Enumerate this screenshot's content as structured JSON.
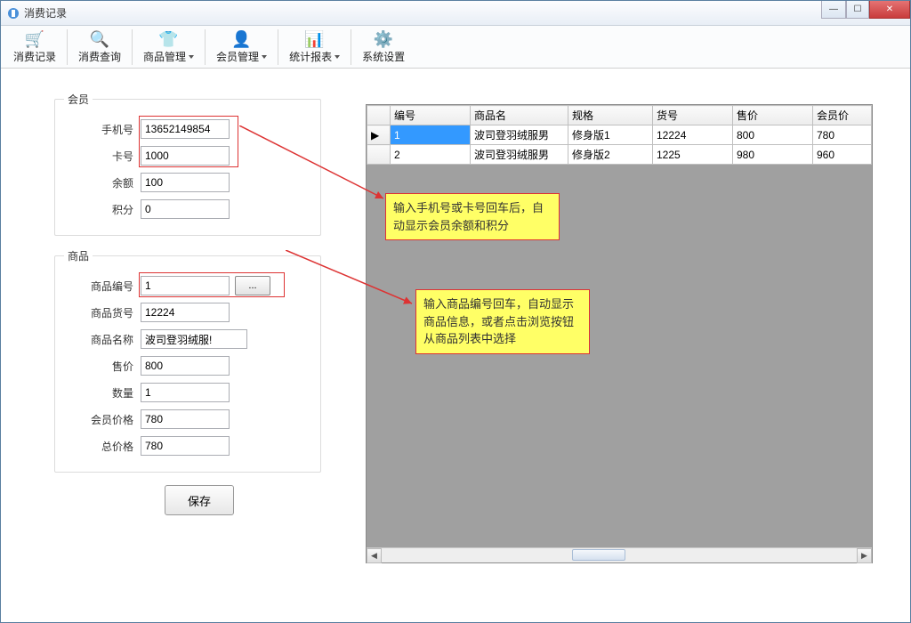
{
  "window": {
    "title": "消费记录"
  },
  "toolbar": [
    {
      "label": "消费记录",
      "dropdown": false
    },
    {
      "label": "消费查询",
      "dropdown": false
    },
    {
      "label": "商品管理",
      "dropdown": true
    },
    {
      "label": "会员管理",
      "dropdown": true
    },
    {
      "label": "统计报表",
      "dropdown": true
    },
    {
      "label": "系统设置",
      "dropdown": false
    }
  ],
  "member": {
    "legend": "会员",
    "phone_label": "手机号",
    "phone_value": "13652149854",
    "card_label": "卡号",
    "card_value": "1000",
    "balance_label": "余额",
    "balance_value": "100",
    "points_label": "积分",
    "points_value": "0"
  },
  "product": {
    "legend": "商品",
    "code_label": "商品编号",
    "code_value": "1",
    "browse_label": "...",
    "sku_label": "商品货号",
    "sku_value": "12224",
    "name_label": "商品名称",
    "name_value": "波司登羽绒服!",
    "price_label": "售价",
    "price_value": "800",
    "qty_label": "数量",
    "qty_value": "1",
    "member_price_label": "会员价格",
    "member_price_value": "780",
    "total_label": "总价格",
    "total_value": "780"
  },
  "save_label": "保存",
  "grid": {
    "headers": [
      "编号",
      "商品名",
      "规格",
      "货号",
      "售价",
      "会员价"
    ],
    "rows": [
      {
        "ptr": "▶",
        "cells": [
          "1",
          "波司登羽绒服男",
          "修身版1",
          "12224",
          "800",
          "780"
        ],
        "selected_col": 0
      },
      {
        "ptr": "",
        "cells": [
          "2",
          "波司登羽绒服男",
          "修身版2",
          "1225",
          "980",
          "960"
        ],
        "selected_col": -1
      }
    ]
  },
  "callouts": {
    "c1": "输入手机号或卡号回车后，自动显示会员余额和积分",
    "c2": "输入商品编号回车，自动显示商品信息，或者点击浏览按钮从商品列表中选择"
  }
}
